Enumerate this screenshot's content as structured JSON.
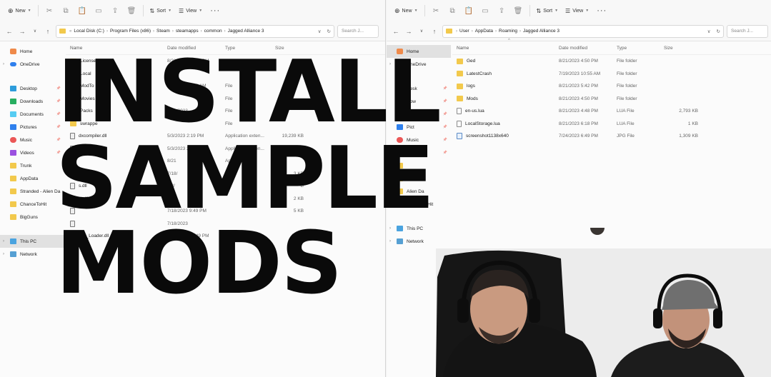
{
  "toolbar": {
    "new_label": "New",
    "sort_label": "Sort",
    "view_label": "View",
    "more_label": "···"
  },
  "left": {
    "path": [
      "Local Disk (C:)",
      "Program Files (x86)",
      "Steam",
      "steamapps",
      "common",
      "Jagged Alliance 3"
    ],
    "search_placeholder": "Search J...",
    "columns": {
      "name": "Name",
      "date": "Date modified",
      "type": "Type",
      "size": "Size"
    },
    "nav": {
      "home": "Home",
      "onedrive": "OneDrive",
      "quick": [
        {
          "label": "Desktop",
          "icon": "desktop-icon"
        },
        {
          "label": "Downloads",
          "icon": "downloads-icon"
        },
        {
          "label": "Documents",
          "icon": "documents-icon"
        },
        {
          "label": "Pictures",
          "icon": "pictures-icon"
        },
        {
          "label": "Music",
          "icon": "music-icon"
        },
        {
          "label": "Videos",
          "icon": "videos-icon"
        },
        {
          "label": "Trunk",
          "icon": "folder-icon"
        },
        {
          "label": "AppData",
          "icon": "folder-icon"
        },
        {
          "label": "Stranded - Alien Da",
          "icon": "folder-icon"
        },
        {
          "label": "ChanceToHit",
          "icon": "folder-icon"
        },
        {
          "label": "BigGuns",
          "icon": "folder-icon"
        }
      ],
      "this_pc": "This PC",
      "network": "Network"
    },
    "files": [
      {
        "name": "Licenses",
        "date": "8/21/2023 12:49 PM",
        "type": "File folder",
        "size": "",
        "kind": "folder"
      },
      {
        "name": "Local",
        "date": "",
        "type": "",
        "size": "",
        "kind": "folder"
      },
      {
        "name": "ModTo",
        "date": "8/23/2023 5:42 AM",
        "type": "File",
        "size": "",
        "kind": "folder"
      },
      {
        "name": "Movies",
        "date": "",
        "type": "File",
        "size": "",
        "kind": "folder"
      },
      {
        "name": "Packs",
        "date": "8/21/2023",
        "type": "File",
        "size": "",
        "kind": "folder"
      },
      {
        "name": "swrappe",
        "date": "",
        "type": "File",
        "size": "",
        "kind": "folder"
      },
      {
        "name": "dxcompiler.dll",
        "date": "5/3/2023 2:19 PM",
        "type": "Application exten...",
        "size": "19,239 KB",
        "kind": "dll"
      },
      {
        "name": "dxil.dll",
        "date": "5/3/2023 2:19 PM",
        "type": "Application exten...",
        "size": "1,462 KB",
        "kind": "dll"
      },
      {
        "name": "",
        "date": "8/21",
        "type": "Applic",
        "size": "",
        "kind": "dll"
      },
      {
        "name": "libxess.dll",
        "date": "7/18/",
        "type": "",
        "size": "3 KB",
        "kind": "dll"
      },
      {
        "name": "s.dll",
        "date": "5/3/",
        "type": "",
        "size": "B",
        "kind": "dll"
      },
      {
        "name": "st.dll",
        "date": "7/18",
        "type": "",
        "size": "2 KB",
        "kind": "dll"
      },
      {
        "name": "",
        "date": "7/18/2023 9:49 PM",
        "type": "",
        "size": "5 KB",
        "kind": "dll"
      },
      {
        "name": "",
        "date": "7/18/2023",
        "type": "",
        "size": "",
        "kind": "dll"
      },
      {
        "name": "API_Loader.dll",
        "date": "8/21/2023 12:49 PM",
        "type": "Application exten...",
        "size": "42 KB",
        "kind": "dll"
      }
    ]
  },
  "right": {
    "path": [
      "User",
      "AppData",
      "Roaming",
      "Jagged Alliance 3"
    ],
    "search_placeholder": "Search J...",
    "columns": {
      "name": "Name",
      "date": "Date modified",
      "type": "Type",
      "size": "Size"
    },
    "nav": {
      "home": "Home",
      "onedrive": "OneDrive",
      "quick": [
        {
          "label": "Desk",
          "icon": "desktop-icon"
        },
        {
          "label": "Dow",
          "icon": "downloads-icon"
        },
        {
          "label": "Docu",
          "icon": "documents-icon"
        },
        {
          "label": "Pict",
          "icon": "pictures-icon"
        },
        {
          "label": "Music",
          "icon": "music-icon"
        },
        {
          "label": "Videos",
          "icon": "videos-icon"
        },
        {
          "label": "",
          "icon": "folder-icon"
        },
        {
          "label": "Data",
          "icon": "folder-icon"
        },
        {
          "label": "Alien Da",
          "icon": "folder-icon"
        },
        {
          "label": "ChanceToHit",
          "icon": "folder-icon"
        }
      ],
      "this_pc": "This PC",
      "network": "Network"
    },
    "files": [
      {
        "name": "Ged",
        "date": "8/21/2023 4:50 PM",
        "type": "File folder",
        "size": "",
        "kind": "folder"
      },
      {
        "name": "LatestCrash",
        "date": "7/19/2023 10:55 AM",
        "type": "File folder",
        "size": "",
        "kind": "folder"
      },
      {
        "name": "logs",
        "date": "8/21/2023 5:42 PM",
        "type": "File folder",
        "size": "",
        "kind": "folder"
      },
      {
        "name": "Mods",
        "date": "8/21/2023 4:50 PM",
        "type": "File folder",
        "size": "",
        "kind": "folder"
      },
      {
        "name": "en-us.lua",
        "date": "8/21/2023 4:48 PM",
        "type": "LUA File",
        "size": "2,793 KB",
        "kind": "file"
      },
      {
        "name": "LocalStorage.lua",
        "date": "8/21/2023 6:18 PM",
        "type": "LUA File",
        "size": "1 KB",
        "kind": "file"
      },
      {
        "name": "screenshot1138x640",
        "date": "7/24/2023 6:49 PM",
        "type": "JPG File",
        "size": "1,309 KB",
        "kind": "img"
      }
    ]
  },
  "overlay": {
    "line1": "INSTALL",
    "line2": "SAMPLE",
    "line3": "MODS"
  }
}
